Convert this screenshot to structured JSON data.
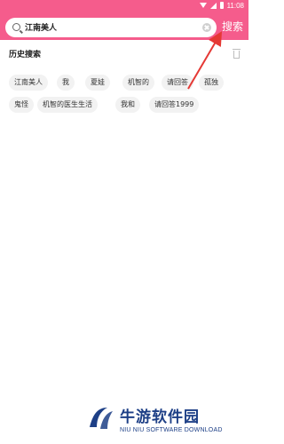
{
  "status_bar": {
    "time": "11:08"
  },
  "search": {
    "value": "江南美人",
    "button_label": "搜索",
    "accent_color": "#f55c8c"
  },
  "history": {
    "title": "历史搜索",
    "chips": [
      "江南美人",
      "我",
      "夏娃",
      "机智的",
      "请回答",
      "孤独",
      "鬼怪",
      "机智的医生生活",
      "我和",
      "请回答1999"
    ]
  },
  "watermark": {
    "brand_cn": "牛游软件园",
    "brand_en": "NIU NIU SOFTWARE DOWNLOAD"
  }
}
